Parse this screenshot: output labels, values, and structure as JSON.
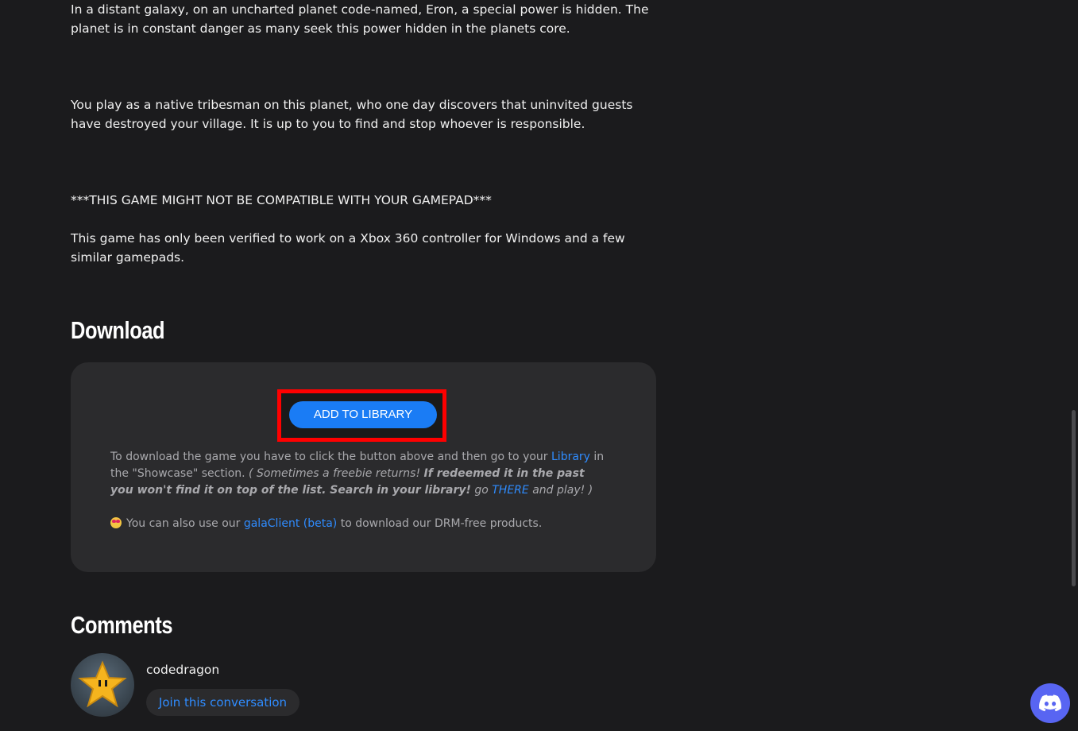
{
  "description": {
    "paragraph1": "In a distant galaxy, on an uncharted planet code-named, Eron, a special power is hidden. The planet is in constant danger as many seek this power hidden in the planets core.",
    "paragraph2": "You play as a native tribesman on this planet, who one day discovers that uninvited guests have destroyed your village. It is up to you to find and stop whoever is responsible.",
    "warning": "***THIS GAME MIGHT NOT BE COMPATIBLE WITH YOUR GAMEPAD***",
    "paragraph4": "This game has only been verified to work on a Xbox 360 controller for Windows and a few similar gamepads."
  },
  "download": {
    "title": "Download",
    "add_button": "ADD TO LIBRARY",
    "info_prefix": "To download the game you have to click the button above and then go to your ",
    "library_link": "Library",
    "info_suffix": " in the \"Showcase\" section. ",
    "italic_open": "( Sometimes a freebie returns! ",
    "bold_italic": "If redeemed it in the past you won't find it on top of the list. Search in your library!",
    "go_text": " go ",
    "there_link": "THERE",
    "italic_close": " and play! )",
    "gala_prefix": "You can also use our ",
    "gala_link": "galaClient (beta)",
    "gala_suffix": " to download our DRM-free products."
  },
  "comments": {
    "title": "Comments",
    "username": "codedragon",
    "join_button": "Join this conversation"
  },
  "colors": {
    "accent": "#1a7cf5",
    "link": "#2f8cff",
    "highlight": "#ff0000",
    "discord": "#5865f2"
  },
  "icons": {
    "emoji": "star-struck-emoji-icon",
    "avatar": "star-avatar-icon",
    "discord": "discord-icon"
  }
}
